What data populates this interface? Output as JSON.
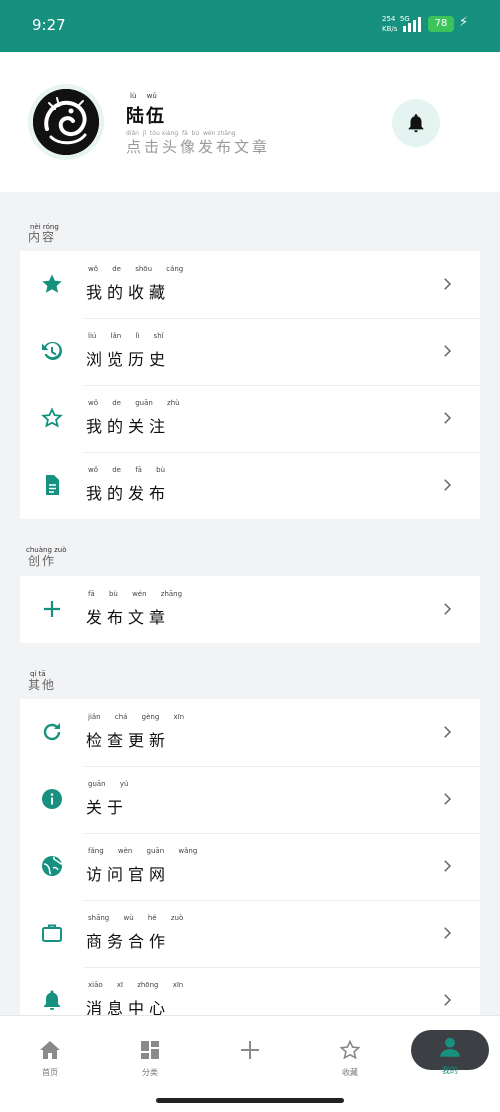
{
  "status_bar": {
    "time": "9:27",
    "net_speed": "254",
    "net_unit": "KB/s",
    "network": "5G",
    "battery": "78"
  },
  "profile": {
    "name": "陆伍",
    "name_pinyin": "lù   wǔ",
    "subtitle": "点击头像发布文章",
    "subtitle_pinyin": "diǎn  jī  tóu xiàng  fā  bù  wén zhāng"
  },
  "sections": [
    {
      "title": "内容",
      "title_pinyin": "nèi róng",
      "items": [
        {
          "label": "我的收藏",
          "pinyin": "wǒ de shōu cáng",
          "icon": "star-filled-icon"
        },
        {
          "label": "浏览历史",
          "pinyin": "liú lǎn lì shǐ",
          "icon": "history-icon"
        },
        {
          "label": "我的关注",
          "pinyin": "wǒ de guān zhù",
          "icon": "star-outline-icon"
        },
        {
          "label": "我的发布",
          "pinyin": "wǒ de fā bù",
          "icon": "document-icon"
        }
      ]
    },
    {
      "title": "创作",
      "title_pinyin": "chuàng zuò",
      "items": [
        {
          "label": "发布文章",
          "pinyin": "fā bù wén zhāng",
          "icon": "plus-icon"
        }
      ]
    },
    {
      "title": "其他",
      "title_pinyin": "qí tā",
      "items": [
        {
          "label": "检查更新",
          "pinyin": "jiǎn chá gèng xīn",
          "icon": "refresh-icon"
        },
        {
          "label": "关于",
          "pinyin": "guān yú",
          "icon": "info-icon"
        },
        {
          "label": "访问官网",
          "pinyin": "fǎng wèn guān wǎng",
          "icon": "globe-icon"
        },
        {
          "label": "商务合作",
          "pinyin": "shāng wù hé zuò",
          "icon": "briefcase-icon"
        },
        {
          "label": "消息中心",
          "pinyin": "xiāo xī zhōng xīn",
          "icon": "bell-icon"
        }
      ]
    }
  ],
  "tabbar": {
    "home": "首页",
    "category": "分类",
    "favorites": "收藏",
    "mine": "我的"
  },
  "colors": {
    "accent": "#17917f",
    "status_bar": "#17917f",
    "background": "#f2f3f5"
  }
}
